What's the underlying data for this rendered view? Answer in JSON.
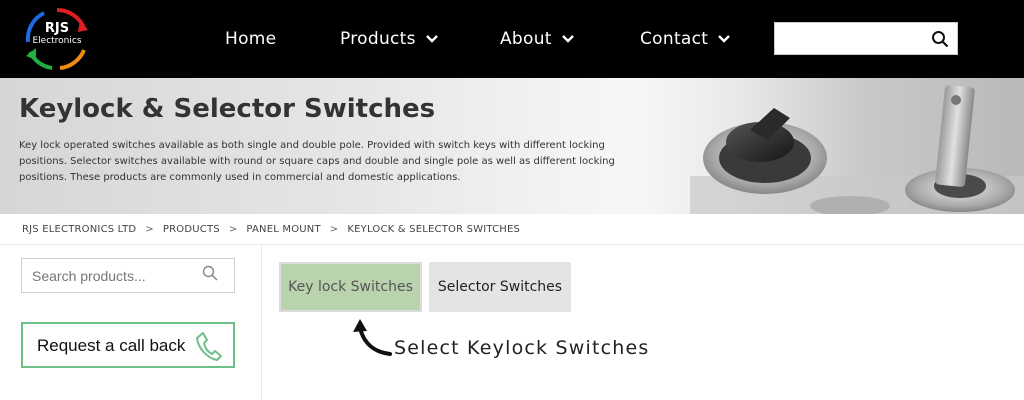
{
  "brand": {
    "line1": "RJS",
    "line2": "Electronics"
  },
  "nav": {
    "home": "Home",
    "products": "Products",
    "about": "About",
    "contact": "Contact"
  },
  "header_search": {
    "placeholder": "",
    "icon": "search-icon"
  },
  "banner": {
    "title": "Keylock & Selector Switches",
    "description": "Key lock operated switches available as both single and double pole. Provided with switch keys with different locking positions. Selector switches available with round or square caps and double and single pole as well as different locking positions. These products are commonly used in commercial and domestic applications."
  },
  "breadcrumb": [
    "RJS ELECTRONICS LTD",
    "PRODUCTS",
    "PANEL MOUNT",
    "KEYLOCK & SELECTOR SWITCHES"
  ],
  "sidebar": {
    "search_placeholder": "Search products...",
    "callback_label": "Request a call back"
  },
  "tabs": {
    "keylock": "Key lock Switches",
    "selector": "Selector Switches"
  },
  "hint": "Select Keylock Switches",
  "colors": {
    "header_bg": "#000000",
    "active_tab": "#b9d3ae",
    "inactive_tab": "#e4e4e4",
    "callback_border": "#6dc08a"
  }
}
